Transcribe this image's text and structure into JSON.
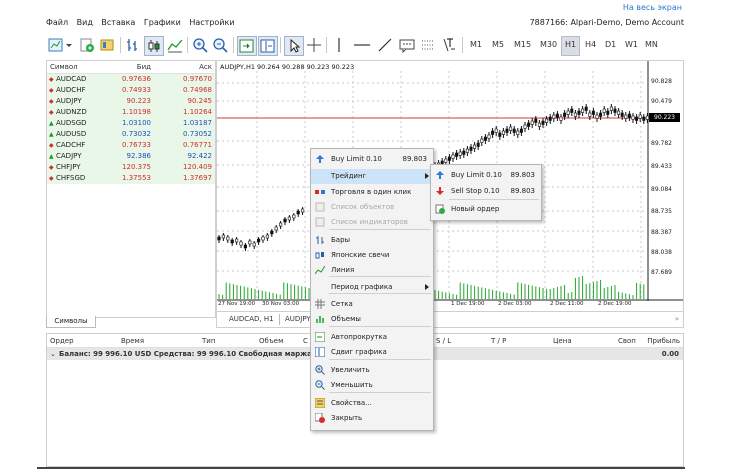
{
  "top_link": "На весь экран",
  "menubar": [
    "Файл",
    "Вид",
    "Вставка",
    "Графики",
    "Настройки"
  ],
  "account": "7887166: Alpari-Demo, Demo Account",
  "timeframes": [
    "M1",
    "M5",
    "M15",
    "M30",
    "H1",
    "H4",
    "D1",
    "W1",
    "MN"
  ],
  "active_timeframe": "H1",
  "market_watch": {
    "headers": {
      "symbol": "Символ",
      "bid": "Бид",
      "ask": "Аск"
    },
    "rows": [
      {
        "symbol": "AUDCAD",
        "bid": "0.97636",
        "ask": "0.97670",
        "dir": "down"
      },
      {
        "symbol": "AUDCHF",
        "bid": "0.74933",
        "ask": "0.74968",
        "dir": "down"
      },
      {
        "symbol": "AUDJPY",
        "bid": "90.223",
        "ask": "90.245",
        "dir": "down"
      },
      {
        "symbol": "AUDNZD",
        "bid": "1.10198",
        "ask": "1.10264",
        "dir": "down"
      },
      {
        "symbol": "AUDSGD",
        "bid": "1.03100",
        "ask": "1.03187",
        "dir": "up"
      },
      {
        "symbol": "AUDUSD",
        "bid": "0.73032",
        "ask": "0.73052",
        "dir": "up"
      },
      {
        "symbol": "CADCHF",
        "bid": "0.76733",
        "ask": "0.76771",
        "dir": "down"
      },
      {
        "symbol": "CADJPY",
        "bid": "92.386",
        "ask": "92.422",
        "dir": "up"
      },
      {
        "symbol": "CHFJPY",
        "bid": "120.375",
        "ask": "120.409",
        "dir": "down"
      },
      {
        "symbol": "CHFSGD",
        "bid": "1.37553",
        "ask": "1.37697",
        "dir": "down"
      }
    ],
    "tab": "Символы"
  },
  "chart": {
    "title": "AUDJPY,H1  90.264 90.288 90.223 90.223",
    "price_labels": [
      "90.828",
      "90.479",
      "90.223",
      "89.782",
      "89.433",
      "89.084",
      "88.735",
      "88.387",
      "88.038",
      "87.689"
    ],
    "current_price": "90.223",
    "time_labels": [
      "27 Nov 19:00",
      "30 Nov 03:00",
      "1 Dec 11:00",
      "1 Dec 19:00",
      "2 Dec 03:00",
      "2 Dec 11:00",
      "2 Dec 19:00"
    ],
    "tabs": [
      "AUDCAD, H1",
      "AUDJPY,"
    ],
    "scroll_glyph": "»"
  },
  "terminal": {
    "headers": [
      "Ордер",
      "Время",
      "Тип",
      "Объем",
      "С",
      "S / L",
      "T / P",
      "Цена",
      "Своп",
      "Прибыль"
    ],
    "balance_line": "Баланс: 99 996.10 USD  Средства: 99 996.10  Свободная маржа: 9",
    "profit_total": "0.00"
  },
  "context_menu": {
    "items": [
      {
        "label": "Buy Limit 0.10",
        "value": "89.803",
        "icon": "buy-limit-icon"
      },
      {
        "label": "Трейдинг",
        "submenu": true,
        "highlight": true
      },
      {
        "label": "Торговля в один клик",
        "icon": "one-click-trading-icon"
      },
      {
        "label": "Список объектов",
        "disabled": true,
        "icon": "objects-list-icon"
      },
      {
        "label": "Список индикаторов",
        "disabled": true,
        "icon": "indicators-list-icon"
      },
      {
        "label": "Бары",
        "icon": "bars-icon"
      },
      {
        "label": "Японские свечи",
        "icon": "candles-icon"
      },
      {
        "label": "Линия",
        "icon": "line-chart-icon"
      },
      {
        "label": "Период графика",
        "submenu": true
      },
      {
        "label": "Сетка",
        "icon": "grid-icon"
      },
      {
        "label": "Объемы",
        "icon": "volumes-icon"
      },
      {
        "label": "Автопрокрутка",
        "icon": "autoscroll-icon"
      },
      {
        "label": "Сдвиг графика",
        "icon": "chart-shift-icon"
      },
      {
        "label": "Увеличить",
        "icon": "zoom-in-icon"
      },
      {
        "label": "Уменьшить",
        "icon": "zoom-out-icon"
      },
      {
        "label": "Свойства...",
        "icon": "properties-icon"
      },
      {
        "label": "Закрыть",
        "icon": "close-chart-icon"
      }
    ]
  },
  "submenu": {
    "items": [
      {
        "label": "Buy Limit 0.10",
        "value": "89.803",
        "icon": "buy-limit-icon"
      },
      {
        "label": "Sell Stop 0.10",
        "value": "89.803",
        "icon": "sell-stop-icon"
      },
      {
        "label": "Новый ордер",
        "icon": "new-order-icon"
      }
    ]
  },
  "colors": {
    "bid_line": "#d43a3a",
    "bullish_volume": "#22a52a",
    "market_row_bg": "#e9f7e9",
    "highlight": "#cde3f7",
    "link": "#2a7ad4"
  }
}
